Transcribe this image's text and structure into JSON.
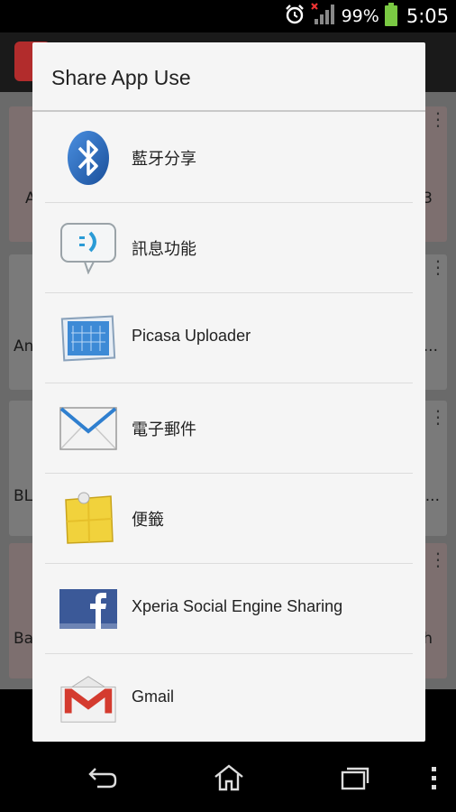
{
  "status_bar": {
    "battery": "99%",
    "time": "5:05",
    "icons": [
      "alarm-icon",
      "no-signal-icon",
      "battery-icon"
    ]
  },
  "background_app": {
    "visible_fragments": [
      "A",
      "3",
      "An",
      "...",
      "BL",
      "...",
      "Ba",
      "h"
    ]
  },
  "dialog": {
    "title": "Share App Use",
    "items": [
      {
        "label": "藍牙分享",
        "icon": "bluetooth-icon"
      },
      {
        "label": "訊息功能",
        "icon": "messaging-icon"
      },
      {
        "label": "Picasa Uploader",
        "icon": "picasa-icon"
      },
      {
        "label": "電子郵件",
        "icon": "email-icon"
      },
      {
        "label": "便籤",
        "icon": "sticky-note-icon"
      },
      {
        "label": "Xperia Social Engine Sharing",
        "icon": "facebook-icon"
      },
      {
        "label": "Gmail",
        "icon": "gmail-icon"
      }
    ]
  },
  "nav_bar": {
    "buttons": [
      "back-icon",
      "home-icon",
      "recents-icon",
      "menu-icon"
    ]
  },
  "colors": {
    "dialog_bg": "#f5f5f5",
    "divider": "#c9c9c9",
    "battery_green": "#7ac943",
    "gmail_red": "#d43b2f",
    "facebook_blue": "#3b5998",
    "bluetooth_blue": "#1f5fae"
  }
}
